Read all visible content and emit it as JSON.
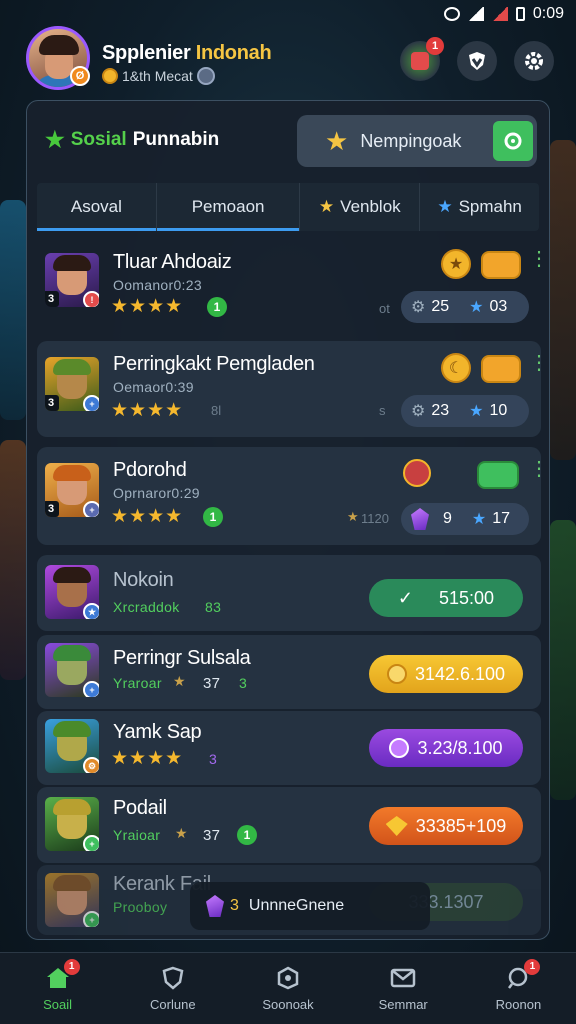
{
  "status": {
    "time": "0:09"
  },
  "profile": {
    "name_part1": "Spplenier ",
    "name_part2": "Indonah",
    "subtitle": "1&th Mecat",
    "level_badge": "Ø"
  },
  "header_buttons": {
    "notif_count": "1"
  },
  "panel": {
    "title_green": "Sosial",
    "title_white": "Punnabin",
    "search_label": "Nempingoak"
  },
  "tabs": [
    {
      "label": "Asoval"
    },
    {
      "label": "Pemoaon"
    },
    {
      "label": "Venblok"
    },
    {
      "label": "Spmahn"
    }
  ],
  "rows": [
    {
      "name": "Tluar Ahdoaiz",
      "sub": "Oomanor0:23",
      "rank": "3",
      "stat_left": "25",
      "stat_right": "03",
      "dim": "ot"
    },
    {
      "name": "Perringkakt Pemgladen",
      "sub": "Oemaor0:39",
      "rank": "3",
      "stat_left": "23",
      "stat_right": "10",
      "dim": "s",
      "dim2": "8l"
    },
    {
      "name": "Pdorohd",
      "sub": "Oprnaror0:29",
      "rank": "3",
      "stat_left": "9",
      "stat_right": "17",
      "dim": "1120"
    },
    {
      "name": "Nokoin",
      "sub": "Xrcraddok",
      "sub2": "83",
      "price": "515:00"
    },
    {
      "name": "Perringr Sulsala",
      "sub": "Yraroar",
      "sub2": "37",
      "sub3": "3",
      "price": "3142.6.100"
    },
    {
      "name": "Yamk Sap",
      "sub3": "3",
      "price": "3.23/8.100"
    },
    {
      "name": "Podail",
      "sub": "Yraioar",
      "sub2": "37",
      "price": "33385+109"
    },
    {
      "name": "Kerank Fail",
      "sub": "Prooboy",
      "price": "333.1307"
    }
  ],
  "toast": {
    "text": "UnnneGnene",
    "prefix": "3"
  },
  "nav": [
    {
      "label": "Soail",
      "badge": "1"
    },
    {
      "label": "Corlune"
    },
    {
      "label": "Soonoak"
    },
    {
      "label": "Semmar"
    },
    {
      "label": "Roonon",
      "badge": "1"
    }
  ],
  "colors": {
    "accent_green": "#52cf5e",
    "accent_blue": "#3d9cf0",
    "gold": "#f5c543",
    "purple": "#9b59ff",
    "orange": "#f06a2b"
  }
}
